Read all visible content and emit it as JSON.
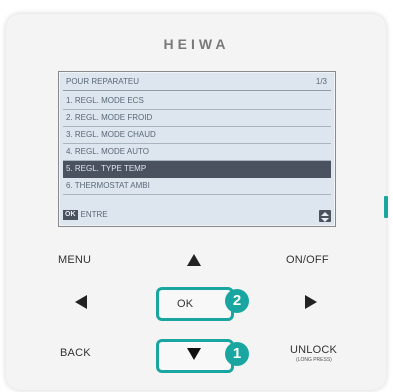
{
  "brand": "HEIWA",
  "screen": {
    "title": "POUR REPARATEU",
    "page": "1/3",
    "items": [
      "1. REGL. MODE ECS",
      "2. REGL. MODE FROID",
      "3. REGL. MODE CHAUD",
      "4. REGL. MODE AUTO",
      "5. REGL. TYPE TEMP",
      "6. THERMOSTAT AMBI"
    ],
    "selected_index": 4,
    "footer_ok": "OK",
    "footer_label": "ENTRE"
  },
  "buttons": {
    "menu": "MENU",
    "on_off": "ON/OFF",
    "ok": "OK",
    "back": "BACK",
    "unlock": "UNLOCK",
    "unlock_sub": "(LONG PRESS)"
  },
  "badges": {
    "ok_step": "2",
    "down_step": "1"
  },
  "colors": {
    "accent": "#1aa6a0",
    "screen_bg": "#dde5ee",
    "selected_bg": "#4a5260"
  }
}
